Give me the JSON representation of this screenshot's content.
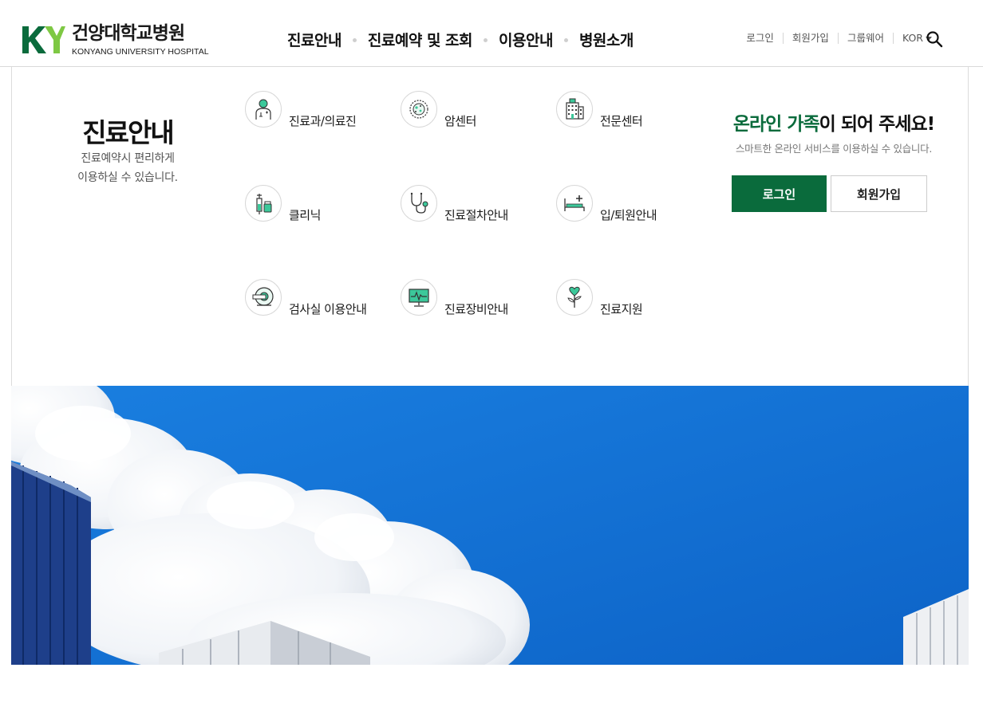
{
  "logo": {
    "mark": "KY",
    "name_ko": "건양대학교병원",
    "name_en": "KONYANG UNIVERSITY HOSPITAL"
  },
  "gnb": [
    "진료안내",
    "진료예약 및 조회",
    "이용안내",
    "병원소개"
  ],
  "util": {
    "login": "로그인",
    "join": "회원가입",
    "groupware": "그룹웨어",
    "lang": "KOR"
  },
  "panel": {
    "title": "진료안내",
    "desc1": "진료예약시 편리하게",
    "desc2": "이용하실 수 있습니다.",
    "items": [
      {
        "label": "진료과/의료진",
        "icon": "doctor-icon"
      },
      {
        "label": "암센터",
        "icon": "cancer-cell-icon"
      },
      {
        "label": "전문센터",
        "icon": "hospital-building-icon"
      },
      {
        "label": "클리닉",
        "icon": "syringe-medicine-icon"
      },
      {
        "label": "진료절차안내",
        "icon": "stethoscope-icon"
      },
      {
        "label": "입/퇴원안내",
        "icon": "hospital-bed-icon"
      },
      {
        "label": "검사실 이용안내",
        "icon": "mri-scanner-icon"
      },
      {
        "label": "진료장비안내",
        "icon": "heart-monitor-icon"
      },
      {
        "label": "진료지원",
        "icon": "heart-plant-icon"
      }
    ]
  },
  "welcome": {
    "title_green": "온라인 가족",
    "title_rest": "이 되어 주세요!",
    "sub": "스마트한 온라인 서비스를 이용하실 수 있습니다.",
    "login_button": "로그인",
    "join_button": "회원가입"
  },
  "colors": {
    "brand_green": "#0a6b3c",
    "logo_light_green": "#7ec843",
    "icon_accent": "#3cc89a",
    "sky_blue": "#0f6fd6"
  }
}
